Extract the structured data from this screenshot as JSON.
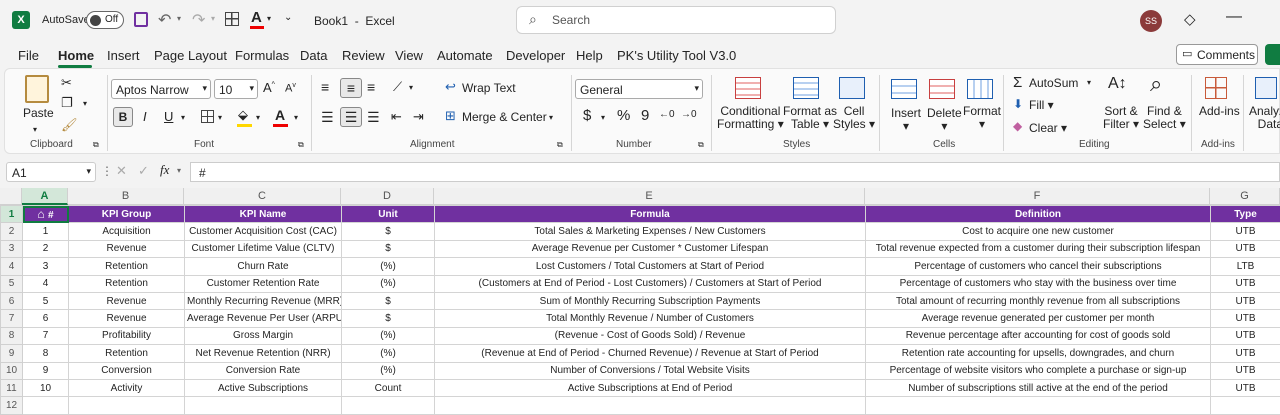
{
  "app": {
    "autosave_label": "AutoSave",
    "autosave_state": "Off",
    "doc_title": "Book1",
    "separator": "-",
    "app_name": "Excel",
    "search_placeholder": "Search",
    "user_initials": "SS"
  },
  "menu": [
    "File",
    "Home",
    "Insert",
    "Page Layout",
    "Formulas",
    "Data",
    "Review",
    "View",
    "Automate",
    "Developer",
    "Help",
    "PK's Utility Tool V3.0"
  ],
  "comments_label": "Comments",
  "ribbon": {
    "clipboard": {
      "paste": "Paste",
      "label": "Clipboard"
    },
    "font": {
      "name": "Aptos Narrow",
      "size": "10",
      "label": "Font",
      "bold": "B",
      "italic": "I",
      "underline": "U"
    },
    "alignment": {
      "wrap": "Wrap Text",
      "merge": "Merge & Center",
      "label": "Alignment"
    },
    "number": {
      "format": "General",
      "currency": "$",
      "percent": "%",
      "comma": "9",
      "label": "Number"
    },
    "styles": {
      "cond1": "Conditional",
      "cond2": "Formatting",
      "fmt1": "Format as",
      "fmt2": "Table",
      "cell1": "Cell",
      "cell2": "Styles",
      "label": "Styles"
    },
    "cells": {
      "insert": "Insert",
      "delete": "Delete",
      "format": "Format",
      "label": "Cells"
    },
    "editing": {
      "autosum": "AutoSum",
      "fill": "Fill",
      "clear": "Clear",
      "sort1": "Sort &",
      "sort2": "Filter",
      "find1": "Find &",
      "find2": "Select",
      "label": "Editing"
    },
    "addins": {
      "btn": "Add-ins",
      "label": "Add-ins"
    },
    "analyze": {
      "l1": "Analyze",
      "l2": "Data"
    }
  },
  "formula_bar": {
    "name_box": "A1",
    "fx": "fx",
    "content": "#"
  },
  "columns": [
    "A",
    "B",
    "C",
    "D",
    "E",
    "F",
    "G"
  ],
  "headers": [
    "#",
    "KPI Group",
    "KPI Name",
    "Unit",
    "Formula",
    "Definition",
    "Type"
  ],
  "rows": [
    [
      "1",
      "Acquisition",
      "Customer Acquisition Cost (CAC)",
      "$",
      "Total Sales & Marketing Expenses / New Customers",
      "Cost to acquire one new customer",
      "UTB"
    ],
    [
      "2",
      "Revenue",
      "Customer Lifetime Value (CLTV)",
      "$",
      "Average Revenue per Customer * Customer Lifespan",
      "Total revenue expected from a customer during their subscription lifespan",
      "UTB"
    ],
    [
      "3",
      "Retention",
      "Churn Rate",
      "(%)",
      "Lost Customers / Total Customers at Start of Period",
      "Percentage of customers who cancel their subscriptions",
      "LTB"
    ],
    [
      "4",
      "Retention",
      "Customer Retention Rate",
      "(%)",
      "(Customers at End of Period - Lost Customers) / Customers at Start of Period",
      "Percentage of customers who stay with the business over time",
      "UTB"
    ],
    [
      "5",
      "Revenue",
      "Monthly Recurring Revenue (MRR)",
      "$",
      "Sum of Monthly Recurring Subscription Payments",
      "Total amount of recurring monthly revenue from all subscriptions",
      "UTB"
    ],
    [
      "6",
      "Revenue",
      "Average Revenue Per User (ARPU)",
      "$",
      "Total Monthly Revenue / Number of Customers",
      "Average revenue generated per customer per month",
      "UTB"
    ],
    [
      "7",
      "Profitability",
      "Gross Margin",
      "(%)",
      "(Revenue - Cost of Goods Sold) / Revenue",
      "Revenue percentage after accounting for cost of goods sold",
      "UTB"
    ],
    [
      "8",
      "Retention",
      "Net Revenue Retention (NRR)",
      "(%)",
      "(Revenue at End of Period - Churned Revenue) / Revenue at Start of Period",
      "Retention rate accounting for upsells, downgrades, and churn",
      "UTB"
    ],
    [
      "9",
      "Conversion",
      "Conversion Rate",
      "(%)",
      "Number of Conversions / Total Website Visits",
      "Percentage of website visitors who complete a purchase or sign-up",
      "UTB"
    ],
    [
      "10",
      "Activity",
      "Active Subscriptions",
      "Count",
      "Active Subscriptions at End of Period",
      "Number of subscriptions still active at the end of the period",
      "UTB"
    ]
  ],
  "row_numbers": [
    "1",
    "2",
    "3",
    "4",
    "5",
    "6",
    "7",
    "8",
    "9",
    "10",
    "11",
    "12"
  ],
  "colors": {
    "header_purple": "#7030a0",
    "excel_green": "#107c41",
    "home_underline": "#107c41"
  }
}
